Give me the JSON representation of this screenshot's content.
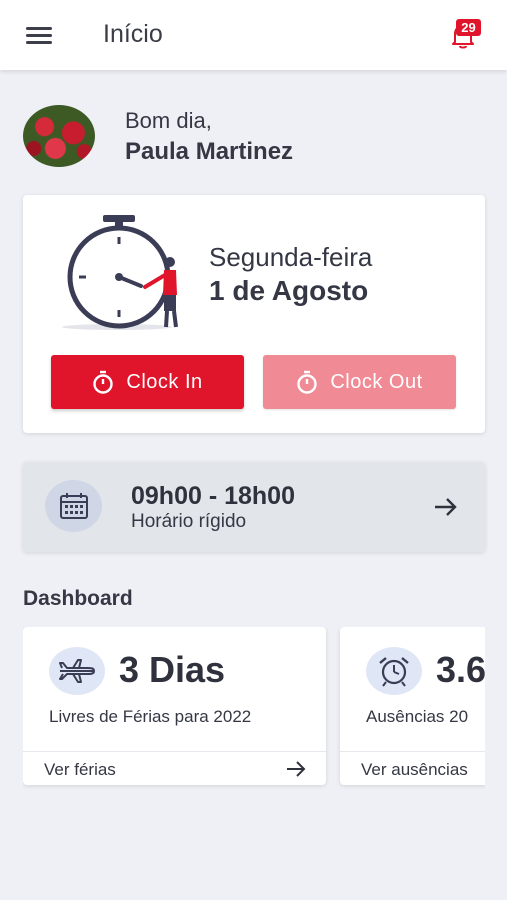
{
  "app_bar": {
    "title": "Início",
    "notification_count": "29",
    "menu_icon": "hamburger-menu-icon",
    "bell_icon": "bell-icon"
  },
  "greeting": {
    "salutation": "Bom dia,",
    "user_name": "Paula Martinez"
  },
  "clock_card": {
    "weekday": "Segunda-feira",
    "date": "1 de Agosto",
    "clock_in_label": "Clock In",
    "clock_out_label": "Clock Out",
    "stopwatch_icon": "stopwatch-icon"
  },
  "schedule": {
    "time_range": "09h00 - 18h00",
    "type": "Horário rígido",
    "calendar_icon": "calendar-icon",
    "arrow_icon": "arrow-right-icon"
  },
  "dashboard": {
    "title": "Dashboard",
    "cards": [
      {
        "value": "3 Dias",
        "description": "Livres de Férias para 2022",
        "link": "Ver férias",
        "icon": "airplane-icon"
      },
      {
        "value": "3.6",
        "description": "Ausências 20",
        "link": "Ver ausências",
        "icon": "alarm-clock-icon"
      }
    ]
  },
  "colors": {
    "accent": "#e0142b",
    "accent_disabled": "#f08a95",
    "background": "#eef0f5",
    "text": "#353844"
  }
}
